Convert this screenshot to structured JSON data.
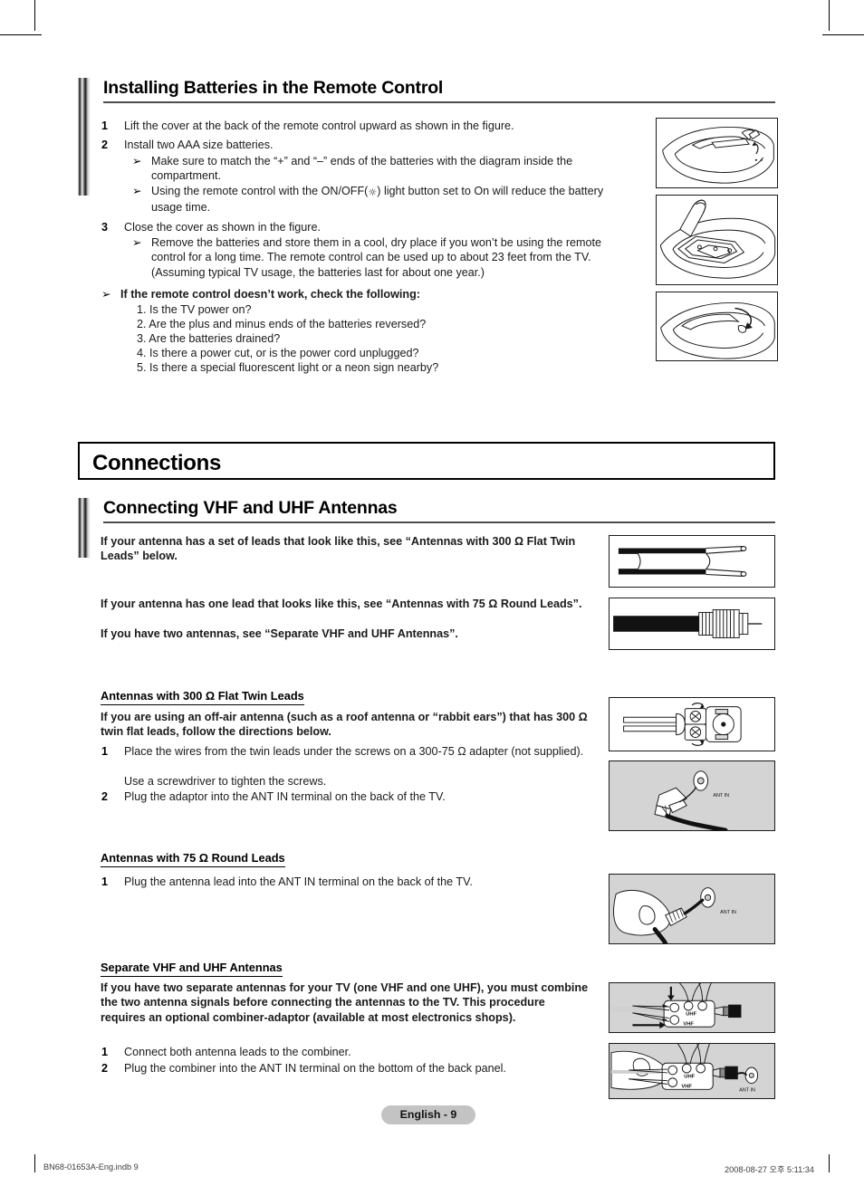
{
  "document": {
    "page_badge": "English - 9",
    "footer_left": "BN68-01653A-Eng.indb   9",
    "footer_right": "2008-08-27   오후 5:11:34"
  },
  "section_batteries": {
    "title": "Installing Batteries in the Remote Control",
    "step1_num": "1",
    "step1_text": "Lift the cover at the back of the remote control upward as shown in the figure.",
    "step2_num": "2",
    "step2_text": "Install two AAA size batteries.",
    "bullet_marker": "➢",
    "step2_b1": "Make sure to match the “+” and “–” ends of the batteries with the diagram inside the compartment.",
    "step2_b2_pre": "Using the remote control with the ON/OFF(",
    "step2_b2_icon": "☼",
    "step2_b2_post": ") light button set to On will reduce the battery usage time.",
    "step3_num": "3",
    "step3_text": "Close the cover as shown in the figure.",
    "step3_b1": "Remove the batteries and store them in a cool, dry place if you won’t be using the remote control for a long time. The remote control can be used up to about 23 feet from the TV. (Assuming typical TV usage, the batteries last for about one year.)",
    "check_heading": "If the remote control doesn’t work, check the following:",
    "checks": [
      "1. Is the TV power on?",
      "2. Are the plus and minus ends of the batteries reversed?",
      "3. Are the batteries drained?",
      "4. Is there a power cut, or is the power cord unplugged?",
      "5. Is there a special fluorescent light or a neon sign nearby?"
    ],
    "figures": [
      "remote-cover-lift-illustration",
      "remote-battery-compartment-illustration",
      "remote-cover-close-illustration"
    ]
  },
  "chapter": {
    "title": "Connections"
  },
  "section_antennas": {
    "title": "Connecting VHF and UHF Antennas",
    "intro1": "If your antenna has a set of leads that look like this, see “Antennas with 300 Ω Flat Twin Leads” below.",
    "intro2_line1": "If your antenna has one lead that looks like this, see “Antennas with 75 Ω Round Leads”.",
    "intro2_line2": "If you have two antennas, see “Separate VHF and UHF Antennas”.",
    "fig_flat_twin": "flat-twin-lead-cable-illustration",
    "fig_round_lead": "round-coaxial-connector-illustration",
    "sub300_head": "Antennas with 300 Ω Flat Twin Leads",
    "sub300_intro": "If you are using an off-air antenna (such as a roof antenna or “rabbit ears”) that has 300 Ω twin flat leads, follow the directions below.",
    "sub300_s1_num": "1",
    "sub300_s1_text": "Place the wires from the twin leads under the screws on a 300-75 Ω adapter (not supplied).",
    "sub300_s1_text2": "Use a screwdriver to tighten the screws.",
    "sub300_s2_num": "2",
    "sub300_s2_text": "Plug the adaptor into the ANT IN terminal on the back of the TV.",
    "fig_adapter": "300-to-75-ohm-adapter-illustration",
    "fig_adapter_plug": "adapter-into-ant-in-illustration",
    "sub75_head": "Antennas with 75 Ω Round Leads",
    "sub75_s1_num": "1",
    "sub75_s1_text": "Plug the antenna lead into the ANT IN terminal on the back of the TV.",
    "fig_hand_coax": "hand-plugging-coax-into-ant-in-illustration",
    "subsep_head": "Separate VHF and UHF Antennas",
    "subsep_intro": "If you have two separate antennas for your TV (one VHF and one UHF), you must combine the two antenna signals before connecting the antennas to the TV. This procedure requires an optional combiner-adaptor (available at most electronics shops).",
    "subsep_s1_num": "1",
    "subsep_s1_text": "Connect both antenna leads to the combiner.",
    "subsep_s2_num": "2",
    "subsep_s2_text": "Plug the combiner into the ANT IN terminal on the bottom of the back panel.",
    "fig_combiner": "combiner-adaptor-wiring-illustration",
    "fig_combiner_plug": "combiner-into-ant-in-illustration",
    "fig_labels": {
      "ant_in": "ANT IN",
      "uhf": "UHF",
      "vhf": "VHF"
    }
  }
}
